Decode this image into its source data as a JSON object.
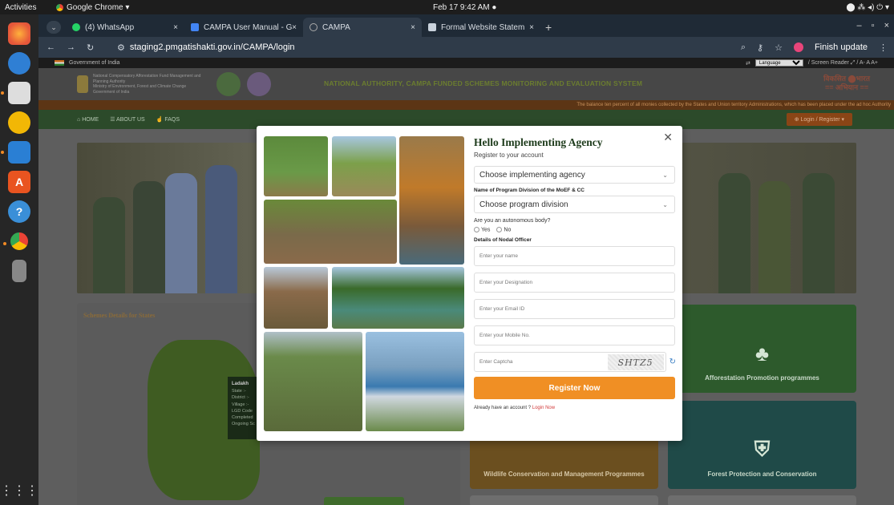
{
  "os": {
    "activities": "Activities",
    "app_menu": "Google Chrome ▾",
    "clock": "Feb 17  9:42 AM  ●",
    "tray": "⬤   ⁂ ◂) ⏻ ▾"
  },
  "browser": {
    "tabs": [
      {
        "label": "(4) WhatsApp",
        "color": "#25d366"
      },
      {
        "label": "CAMPA User Manual - G",
        "color": "#4285f4"
      },
      {
        "label": "CAMPA",
        "color": "#9aa5b1"
      },
      {
        "label": "Formal Website Statem",
        "color": "#9aa5b1"
      }
    ],
    "url": "staging2.pmgatishakti.gov.in/CAMPA/login",
    "finish_update": "Finish update"
  },
  "site": {
    "gov_label": "Government of India",
    "screen_reader": "/ Screen Reader  ⤢  /  A-  A  A+",
    "language": "Language",
    "org_lines": "National Compensatory Afforestation Fund Management and Planning Authority\nMinistry of Environment, Forest and Climate Change\nGovernment of India",
    "title": "NATIONAL AUTHORITY, CAMPA FUNDED SCHEMES MONITORING AND EVALUATION SYSTEM",
    "viksit": "विकसित ⬤भारत\n== अभियान ==",
    "ticker": "The balance ten percent of all monies collected by the States and Union territory Administrations, which has been placed under the ad hoc Authority",
    "nav": {
      "home": "HOME",
      "about": "ABOUT US",
      "faqs": "FAQS",
      "login": "⊕ Login / Register ▾"
    },
    "states_title": "Schemes Details for States",
    "tooltip": {
      "title": "Ladakh",
      "lines": [
        "State :-",
        "District :-",
        "Village :-",
        "LGD Code",
        "Completed",
        "Ongoing Sc"
      ]
    },
    "cards": {
      "afforestation": "Afforestation Promotion programmes",
      "wildlife": "Wildlife Conservation and Management Programmes",
      "forest": "Forest Protection and Conservation"
    }
  },
  "modal": {
    "title": "Hello Implementing Agency",
    "subtitle": "Register to your account",
    "agency_select": "Choose implementing agency",
    "division_label": "Name of Program Division of the MoEF & CC",
    "division_select": "Choose program division",
    "autonomous_q": "Are you an autonomous body?",
    "yes": "Yes",
    "no": "No",
    "nodal_label": "Details of Nodal Officer",
    "name_ph": "Enter your name",
    "designation_ph": "Enter your Designation",
    "email_ph": "Enter your Email ID",
    "mobile_ph": "Enter your Mobile No.",
    "captcha_ph": "Enter Captcha",
    "captcha_text": "SHTZ5",
    "register": "Register Now",
    "already": "Already have an account ?",
    "login_now": "Login Now"
  }
}
